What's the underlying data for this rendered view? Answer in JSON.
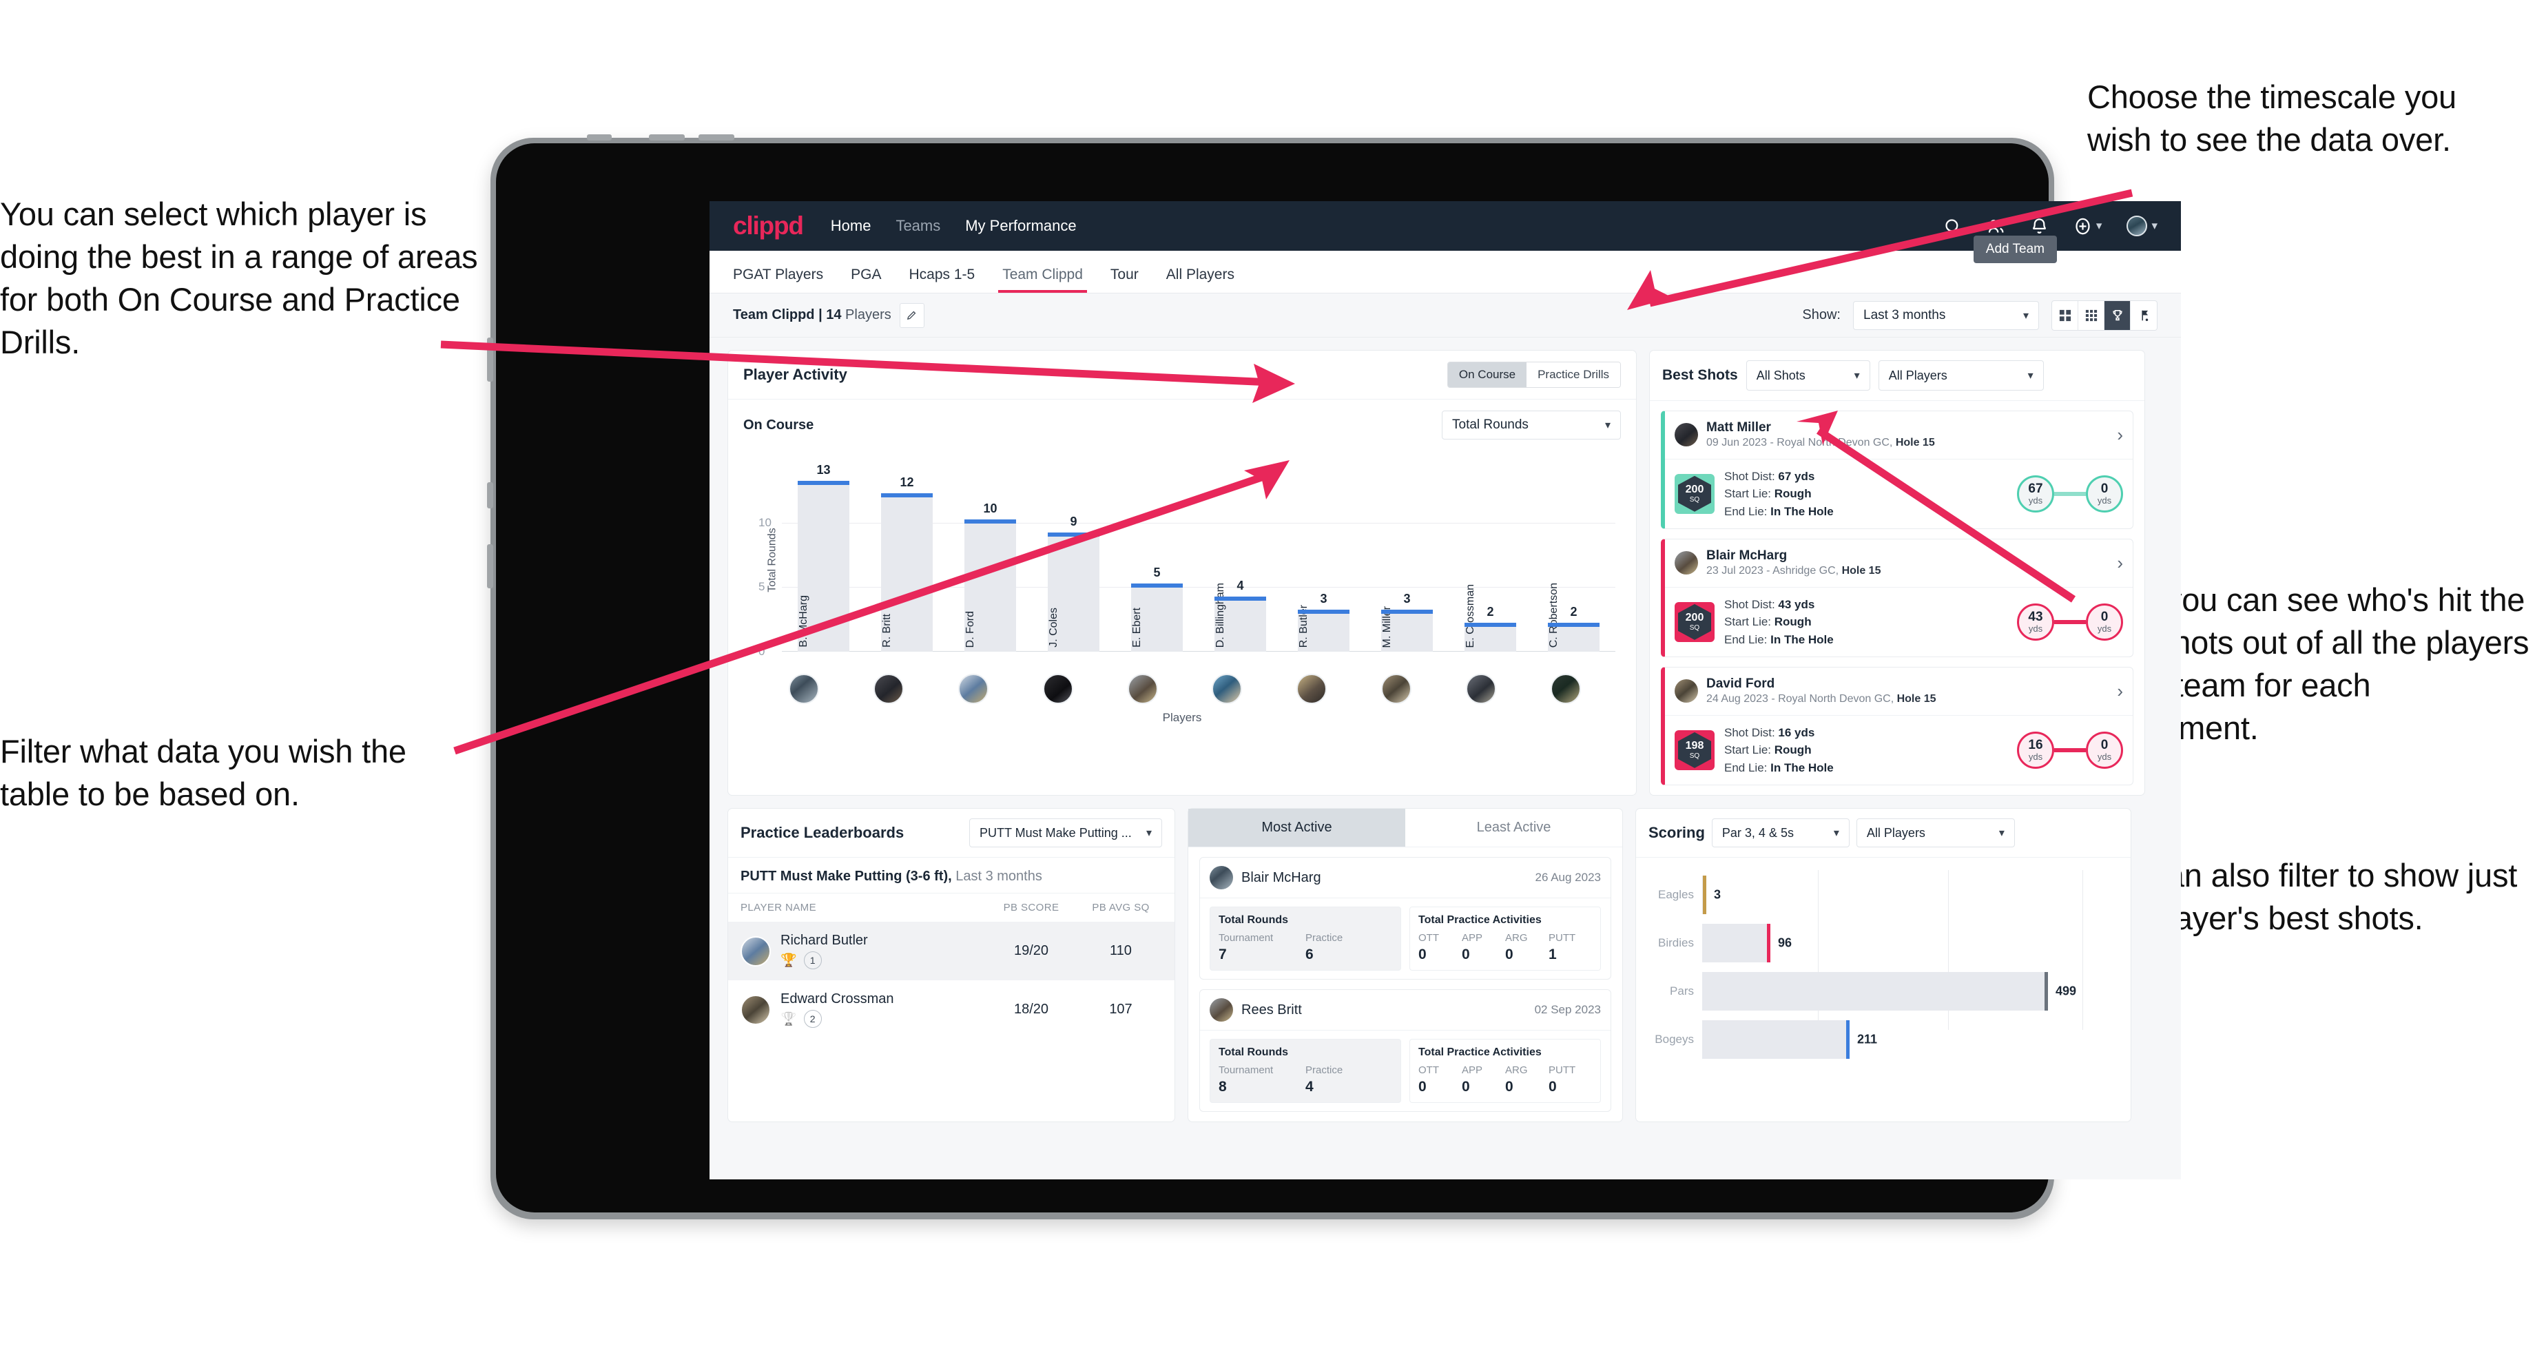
{
  "annotations": {
    "left_top": "You can select which player is doing the best in a range of areas for both On Course and Practice Drills.",
    "left_bottom": "Filter what data you wish the table to be based on.",
    "right_top": "Choose the timescale you wish to see the data over.",
    "right_mid": "Here you can see who's hit the best shots out of all the players in the team for each department.",
    "right_bottom": "You can also filter to show just one player's best shots."
  },
  "topnav": {
    "logo": "clippd",
    "links": [
      {
        "label": "Home",
        "dim": false
      },
      {
        "label": "Teams",
        "dim": true
      },
      {
        "label": "My Performance",
        "dim": false
      }
    ],
    "icons": [
      "search-icon",
      "people-icon",
      "bell-icon",
      "plus-circle-icon",
      "avatar"
    ]
  },
  "tabs": {
    "items": [
      "PGAT Players",
      "PGA",
      "Hcaps 1-5",
      "Team Clippd",
      "Tour",
      "All Players"
    ],
    "active_index": 3,
    "tooltip": "Add Team"
  },
  "subbar": {
    "team_label_bold": "Team Clippd | 14",
    "team_label_rest": " Players",
    "show_label": "Show:",
    "timescale": "Last 3 months",
    "view_icons": [
      "grid-large-icon",
      "grid-small-icon",
      "trophy-icon",
      "flag-icon"
    ],
    "active_view_index": 2
  },
  "player_activity": {
    "title": "Player Activity",
    "toggle": {
      "options": [
        "On Course",
        "Practice Drills"
      ],
      "active": 0
    },
    "sub_title": "On Course",
    "metric": "Total Rounds",
    "xaxis_label": "Players"
  },
  "chart_data": [
    {
      "type": "bar",
      "title": "Player Activity",
      "xlabel": "Players",
      "ylabel": "Total Rounds",
      "categories": [
        "B. McHarg",
        "R. Britt",
        "D. Ford",
        "J. Coles",
        "E. Ebert",
        "D. Billingham",
        "R. Butler",
        "M. Miller",
        "E. Crossman",
        "C. Robertson"
      ],
      "values": [
        13,
        12,
        10,
        9,
        5,
        4,
        3,
        3,
        2,
        2
      ],
      "ylim": [
        0,
        14
      ],
      "yticks": [
        0,
        5,
        10
      ],
      "grid": true
    },
    {
      "type": "bar",
      "orientation": "horizontal",
      "title": "Scoring",
      "categories": [
        "Eagles",
        "Birdies",
        "Pars",
        "Bogeys"
      ],
      "values": [
        3,
        96,
        499,
        211
      ],
      "colors": [
        "#c49b49",
        "#e8275a",
        "#6b737d",
        "#3b7ddd"
      ],
      "xlim": [
        0,
        600
      ],
      "grid": true
    }
  ],
  "best_shots": {
    "title": "Best Shots",
    "filter_shots": "All Shots",
    "filter_players": "All Players",
    "cards": [
      {
        "player": "Matt Miller",
        "meta_prefix": "09 Jun 2023 - Royal North Devon GC, ",
        "meta_hole": "Hole 15",
        "sq": "200",
        "sq_unit": "SQ",
        "accent": "#4ecfb0",
        "shot_dist_label": "Shot Dist: ",
        "shot_dist": "67 yds",
        "start_lie_label": "Start Lie: ",
        "start_lie": "Rough",
        "end_lie_label": "End Lie: ",
        "end_lie": "In The Hole",
        "from_val": "67",
        "from_unit": "yds",
        "to_val": "0",
        "to_unit": "yds"
      },
      {
        "player": "Blair McHarg",
        "meta_prefix": "23 Jul 2023 - Ashridge GC, ",
        "meta_hole": "Hole 15",
        "sq": "200",
        "sq_unit": "SQ",
        "accent": "#e8275a",
        "shot_dist_label": "Shot Dist: ",
        "shot_dist": "43 yds",
        "start_lie_label": "Start Lie: ",
        "start_lie": "Rough",
        "end_lie_label": "End Lie: ",
        "end_lie": "In The Hole",
        "from_val": "43",
        "from_unit": "yds",
        "to_val": "0",
        "to_unit": "yds"
      },
      {
        "player": "David Ford",
        "meta_prefix": "24 Aug 2023 - Royal North Devon GC, ",
        "meta_hole": "Hole 15",
        "sq": "198",
        "sq_unit": "SQ",
        "accent": "#e8275a",
        "shot_dist_label": "Shot Dist: ",
        "shot_dist": "16 yds",
        "start_lie_label": "Start Lie: ",
        "start_lie": "Rough",
        "end_lie_label": "End Lie: ",
        "end_lie": "In The Hole",
        "from_val": "16",
        "from_unit": "yds",
        "to_val": "0",
        "to_unit": "yds"
      }
    ]
  },
  "practice_leaderboards": {
    "title": "Practice Leaderboards",
    "drill_select": "PUTT Must Make Putting ...",
    "subtitle_bold": "PUTT Must Make Putting (3-6 ft),",
    "subtitle_rest": " Last 3 months",
    "columns": [
      "PLAYER NAME",
      "PB SCORE",
      "PB AVG SQ"
    ],
    "rows": [
      {
        "name": "Richard Butler",
        "rank": "1",
        "trophy": "gold",
        "pb_score": "19/20",
        "pb_avg_sq": "110"
      },
      {
        "name": "Edward Crossman",
        "rank": "2",
        "trophy": "silver",
        "pb_score": "18/20",
        "pb_avg_sq": "107"
      }
    ]
  },
  "activity": {
    "tabs": [
      "Most Active",
      "Least Active"
    ],
    "active_index": 0,
    "cards": [
      {
        "player": "Blair McHarg",
        "date": "26 Aug 2023",
        "rounds_title": "Total Rounds",
        "rounds_keys": [
          "Tournament",
          "Practice"
        ],
        "rounds_vals": [
          "7",
          "6"
        ],
        "practice_title": "Total Practice Activities",
        "practice_keys": [
          "OTT",
          "APP",
          "ARG",
          "PUTT"
        ],
        "practice_vals": [
          "0",
          "0",
          "0",
          "1"
        ]
      },
      {
        "player": "Rees Britt",
        "date": "02 Sep 2023",
        "rounds_title": "Total Rounds",
        "rounds_keys": [
          "Tournament",
          "Practice"
        ],
        "rounds_vals": [
          "8",
          "4"
        ],
        "practice_title": "Total Practice Activities",
        "practice_keys": [
          "OTT",
          "APP",
          "ARG",
          "PUTT"
        ],
        "practice_vals": [
          "0",
          "0",
          "0",
          "0"
        ]
      }
    ]
  },
  "scoring": {
    "title": "Scoring",
    "filter_par": "Par 3, 4 & 5s",
    "filter_players": "All Players"
  },
  "colors": {
    "brand_pink": "#e8275a",
    "nav_navy": "#1b2735",
    "bar_blue": "#3b7ddd",
    "teal": "#4ecfb0",
    "bar_grey": "#e7e9ee"
  }
}
